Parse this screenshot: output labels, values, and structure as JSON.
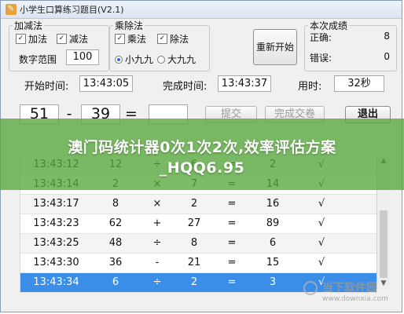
{
  "window": {
    "title": "小学生口算练习题目(V2.1)"
  },
  "add_sub": {
    "title": "加减法",
    "add": {
      "label": "加法",
      "checked": true
    },
    "sub": {
      "label": "减法",
      "checked": true
    },
    "range_label": "数字范围",
    "range_value": "100"
  },
  "mul_div": {
    "title": "乘除法",
    "mul": {
      "label": "乘法",
      "checked": true
    },
    "div": {
      "label": "除法",
      "checked": true
    },
    "small": {
      "label": "小九九",
      "selected": true
    },
    "big": {
      "label": "大九九",
      "selected": false
    }
  },
  "restart_label": "重新开始",
  "score": {
    "title": "本次成绩",
    "correct_label": "正确:",
    "correct_value": "8",
    "wrong_label": "错误:",
    "wrong_value": "0"
  },
  "timing": {
    "start_label": "开始时间:",
    "start_value": "13:43:05",
    "finish_label": "完成时间:",
    "finish_value": "13:43:37",
    "used_label": "用时:",
    "used_value": "32秒"
  },
  "question": {
    "a": "51",
    "op": "-",
    "b": "39",
    "eq": "=",
    "answer": ""
  },
  "buttons": {
    "submit": "提交",
    "finish": "完成交卷",
    "exit": "退出"
  },
  "history": {
    "rows": [
      {
        "time": "13:43:12",
        "a": "12",
        "op": "÷",
        "b": "6",
        "eq": "=",
        "answer": "2",
        "mark": "√"
      },
      {
        "time": "13:43:14",
        "a": "2",
        "op": "×",
        "b": "7",
        "eq": "=",
        "answer": "14",
        "mark": "√"
      },
      {
        "time": "13:43:17",
        "a": "8",
        "op": "×",
        "b": "2",
        "eq": "=",
        "answer": "16",
        "mark": "√"
      },
      {
        "time": "13:43:23",
        "a": "62",
        "op": "+",
        "b": "27",
        "eq": "=",
        "answer": "89",
        "mark": "√"
      },
      {
        "time": "13:43:25",
        "a": "48",
        "op": "÷",
        "b": "8",
        "eq": "=",
        "answer": "6",
        "mark": "√"
      },
      {
        "time": "13:43:30",
        "a": "36",
        "op": "-",
        "b": "21",
        "eq": "=",
        "answer": "15",
        "mark": "√"
      },
      {
        "time": "13:43:34",
        "a": "6",
        "op": "÷",
        "b": "2",
        "eq": "=",
        "answer": "3",
        "mark": "√"
      }
    ]
  },
  "overlay": {
    "line1": "澳门码统计器0次1次2次,效率评估方案",
    "line2": "_HQQ6.95"
  },
  "watermark": {
    "big": "当下软件园",
    "small": "www.downxia.com"
  },
  "colors": {
    "selected_row": "#3a8ee8",
    "overlay_green": "#56a83a"
  }
}
